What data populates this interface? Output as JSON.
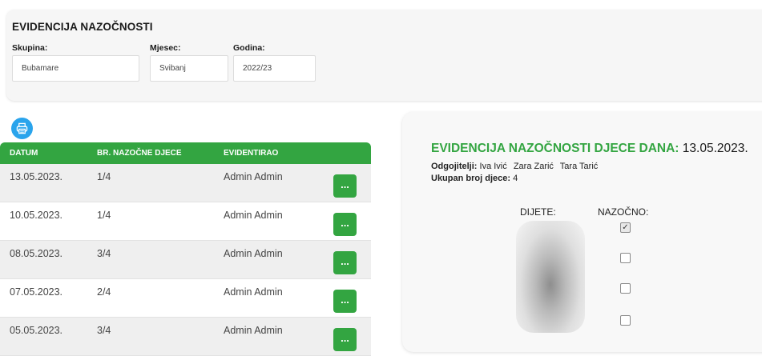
{
  "filters": {
    "title": "EVIDENCIJA NAZOČNOSTI",
    "group_label": "Skupina:",
    "group_value": "Bubamare",
    "month_label": "Mjesec:",
    "month_value": "Svibanj",
    "year_label": "Godina:",
    "year_value": "2022/23"
  },
  "print_icon": "printer-icon",
  "table": {
    "headers": [
      "DATUM",
      "BR. NAZOČNE DJECE",
      "EVIDENTIRAO"
    ],
    "rows": [
      {
        "date": "13.05.2023.",
        "count": "1/4",
        "by": "Admin Admin"
      },
      {
        "date": "10.05.2023.",
        "count": "1/4",
        "by": "Admin Admin"
      },
      {
        "date": "08.05.2023.",
        "count": "3/4",
        "by": "Admin Admin"
      },
      {
        "date": "07.05.2023.",
        "count": "2/4",
        "by": "Admin Admin"
      },
      {
        "date": "05.05.2023.",
        "count": "3/4",
        "by": "Admin Admin"
      }
    ],
    "action_label": "..."
  },
  "detail": {
    "title": "EVIDENCIJA NAZOČNOSTI DJECE DANA:",
    "date": "13.05.2023.",
    "teachers_label": "Odgojitelji:",
    "teachers": [
      "Iva Ivić",
      "Zara Zarić",
      "Tara Tarić"
    ],
    "total_label": "Ukupan broj djece:",
    "total_value": "4",
    "child_header": "DIJETE:",
    "present_header": "NAZOČNO:",
    "attendance": [
      true,
      false,
      false,
      false
    ]
  },
  "colors": {
    "accent_green": "#33a541",
    "print_button": "#2aa4ec"
  }
}
